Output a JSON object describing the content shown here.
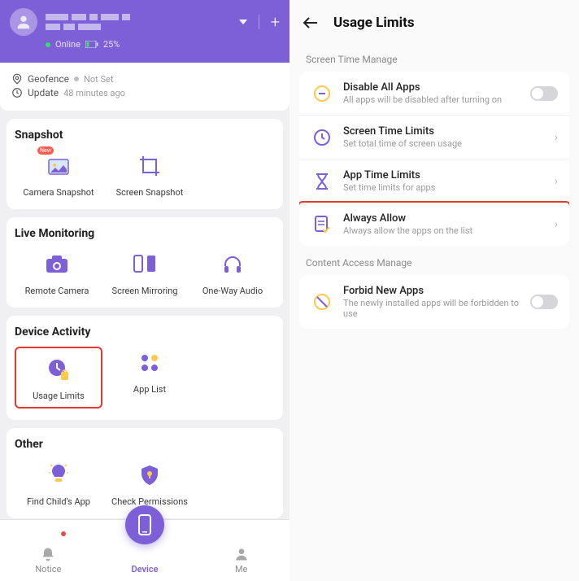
{
  "colors": {
    "accent": "#7d5fd7",
    "highlight": "#e33b2e"
  },
  "left": {
    "status": {
      "online": "Online",
      "battery": "25%"
    },
    "info": {
      "geofence_label": "Geofence",
      "geofence_value": "Not Set",
      "update_label": "Update",
      "update_value": "48 minutes ago"
    },
    "snapshot": {
      "title": "Snapshot",
      "items": [
        "Camera Snapshot",
        "Screen Snapshot"
      ],
      "new_badge": "New"
    },
    "live": {
      "title": "Live Monitoring",
      "items": [
        "Remote Camera",
        "Screen Mirroring",
        "One-Way Audio"
      ]
    },
    "activity": {
      "title": "Device Activity",
      "items": [
        "Usage Limits",
        "App List"
      ]
    },
    "other": {
      "title": "Other",
      "items": [
        "Find Child's App",
        "Check Permissions"
      ]
    },
    "nav": {
      "notice": "Notice",
      "device": "Device",
      "me": "Me"
    }
  },
  "right": {
    "title": "Usage Limits",
    "section1_label": "Screen Time Manage",
    "items1": [
      {
        "title": "Disable All Apps",
        "desc": "All apps will be disabled after turning on"
      },
      {
        "title": "Screen Time Limits",
        "desc": "Set total time of screen usage"
      },
      {
        "title": "App Time Limits",
        "desc": "Set time limits for apps"
      },
      {
        "title": "Always Allow",
        "desc": "Always allow the apps on the list"
      }
    ],
    "section2_label": "Content Access Manage",
    "items2": [
      {
        "title": "Forbid New Apps",
        "desc": "The newly installed apps will be forbidden to use"
      }
    ]
  }
}
